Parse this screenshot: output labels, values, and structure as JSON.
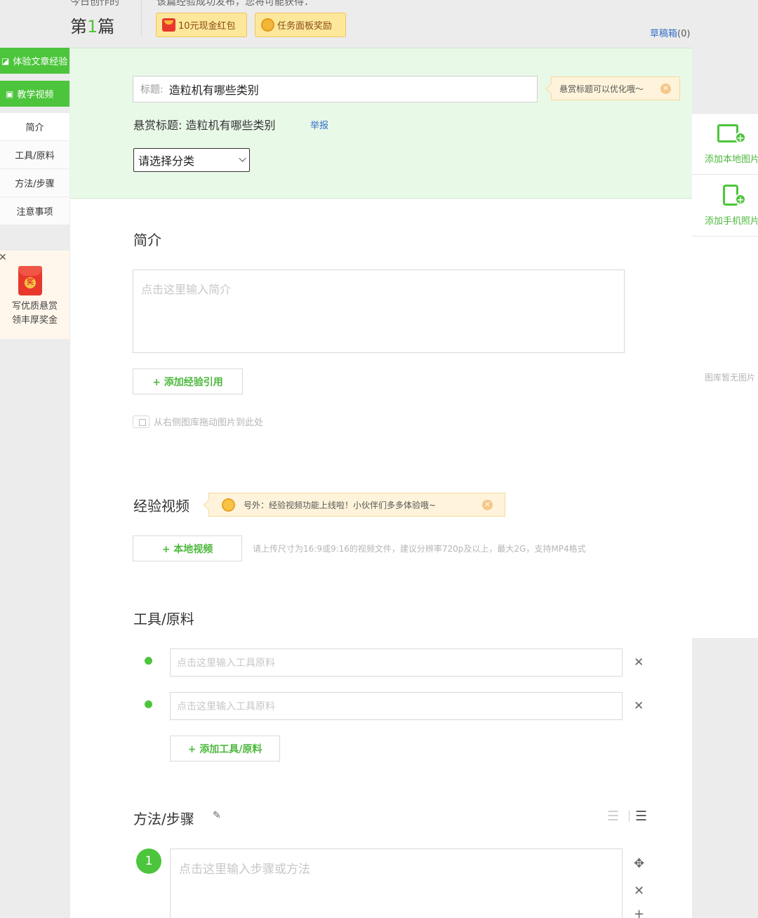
{
  "header": {
    "today_label": "今日创作的",
    "count_prefix": "第",
    "count_num": "1",
    "count_suffix": "篇",
    "reward_note": "该篇经验成功发布，您将可能获得：",
    "rewards": [
      "10元现金红包",
      "任务面板奖励"
    ],
    "draft_label": "草稿箱",
    "draft_count": "(0)"
  },
  "nav": {
    "mode_experience": "体验文章经验",
    "mode_video": "教学视频",
    "items": [
      "简介",
      "工具/原料",
      "方法/步骤",
      "注意事项"
    ]
  },
  "promo": {
    "badge": "奖",
    "line1": "写优质悬赏",
    "line2": "领丰厚奖金"
  },
  "form": {
    "title_label": "标题:",
    "title_value": "造粒机有哪些类别",
    "title_tip": "悬赏标题可以优化哦～",
    "reward_title_label": "悬赏标题:",
    "reward_title_value": "造粒机有哪些类别",
    "report_label": "举报",
    "category_value": "请选择分类"
  },
  "intro": {
    "heading": "简介",
    "placeholder": "点击这里输入简介",
    "add_ref_button": "+ 添加经验引用",
    "drag_hint": "从右侧图库拖动图片到此处"
  },
  "video": {
    "heading": "经验视频",
    "tip": "号外：经验视频功能上线啦！小伙伴们多多体验哦~",
    "local_button": "+ 本地视频",
    "upload_hint": "请上传尺寸为16:9或9:16的视频文件，建议分辨率720p及以上，最大2G，支持MP4格式"
  },
  "tools": {
    "heading": "工具/原料",
    "placeholders": [
      "点击这里输入工具原料",
      "点击这里输入工具原料"
    ],
    "add_button": "+ 添加工具/原料"
  },
  "steps": {
    "heading": "方法/步骤",
    "first_number": "1",
    "placeholder": "点击这里输入步骤或方法"
  },
  "right_panel": {
    "add_local_image": "添加本地图片",
    "add_phone_photo": "添加手机照片",
    "empty_library": "图库暂无图片"
  }
}
